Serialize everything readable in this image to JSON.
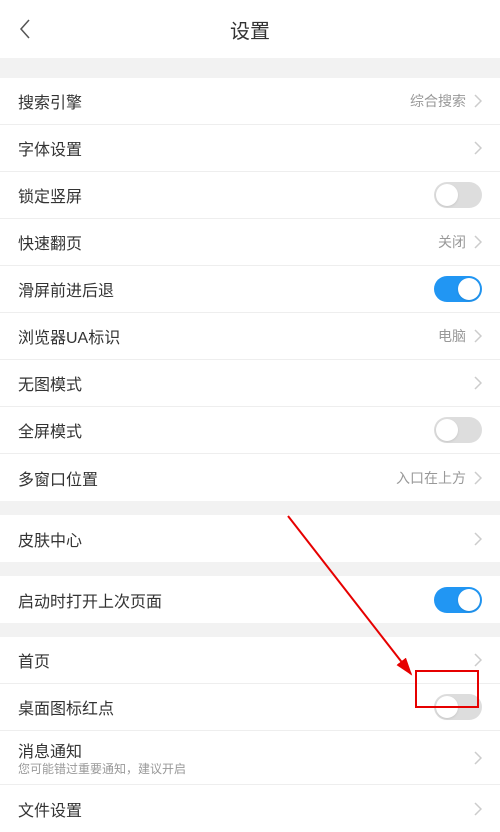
{
  "header": {
    "title": "设置"
  },
  "groups": [
    [
      {
        "label": "搜索引擎",
        "value": "综合搜索",
        "type": "link"
      },
      {
        "label": "字体设置",
        "type": "nav"
      },
      {
        "label": "锁定竖屏",
        "type": "toggle",
        "on": false
      },
      {
        "label": "快速翻页",
        "value": "关闭",
        "type": "link"
      },
      {
        "label": "滑屏前进后退",
        "type": "toggle",
        "on": true
      },
      {
        "label": "浏览器UA标识",
        "value": "电脑",
        "type": "link"
      },
      {
        "label": "无图模式",
        "type": "nav"
      },
      {
        "label": "全屏模式",
        "type": "toggle",
        "on": false
      },
      {
        "label": "多窗口位置",
        "value": "入口在上方",
        "type": "link"
      }
    ],
    [
      {
        "label": "皮肤中心",
        "type": "nav"
      }
    ],
    [
      {
        "label": "启动时打开上次页面",
        "type": "toggle",
        "on": true
      }
    ],
    [
      {
        "label": "首页",
        "type": "nav"
      },
      {
        "label": "桌面图标红点",
        "type": "toggle",
        "on": false
      },
      {
        "label": "消息通知",
        "sub": "您可能错过重要通知，建议开启",
        "type": "nav-tall"
      },
      {
        "label": "文件设置",
        "type": "nav"
      }
    ]
  ]
}
